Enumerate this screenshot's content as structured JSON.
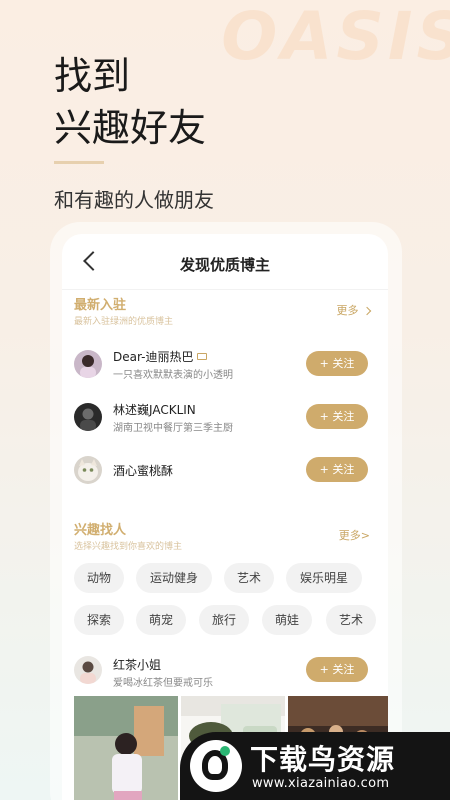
{
  "brand_bg": "OASIS",
  "headline": {
    "line1": "找到",
    "line2": "兴趣好友"
  },
  "subline": "和有趣的人做朋友",
  "nav": {
    "title": "发现优质博主"
  },
  "newcomers": {
    "title": "最新入驻",
    "subtitle": "最新入驻绿洲的优质博主",
    "more": "更多",
    "users": [
      {
        "name": "Dear-迪丽热巴",
        "desc": "一只喜欢默默表演的小透明",
        "follow": "+ 关注"
      },
      {
        "name": "林述巍JACKLIN",
        "desc": "湖南卫视中餐厅第三季主厨",
        "follow": "+ 关注"
      },
      {
        "name": "酒心蜜桃酥",
        "desc": "",
        "follow": "+ 关注"
      }
    ]
  },
  "interests": {
    "title": "兴趣找人",
    "subtitle": "选择兴趣找到你喜欢的博主",
    "more": "更多>",
    "tags": [
      "动物",
      "运动健身",
      "艺术",
      "娱乐明星",
      "探索",
      "萌宠",
      "旅行",
      "萌娃",
      "艺术"
    ]
  },
  "feed": {
    "name": "红茶小姐",
    "desc": "爱喝冰红茶但要戒可乐",
    "follow": "+ 关注"
  },
  "watermark": {
    "title": "下载鸟资源",
    "url": "www.xiazainiao.com"
  },
  "colors": {
    "accent": "#cfab6c",
    "accent_text": "#d1ae6f",
    "tag_bg": "#f2f2f2"
  }
}
